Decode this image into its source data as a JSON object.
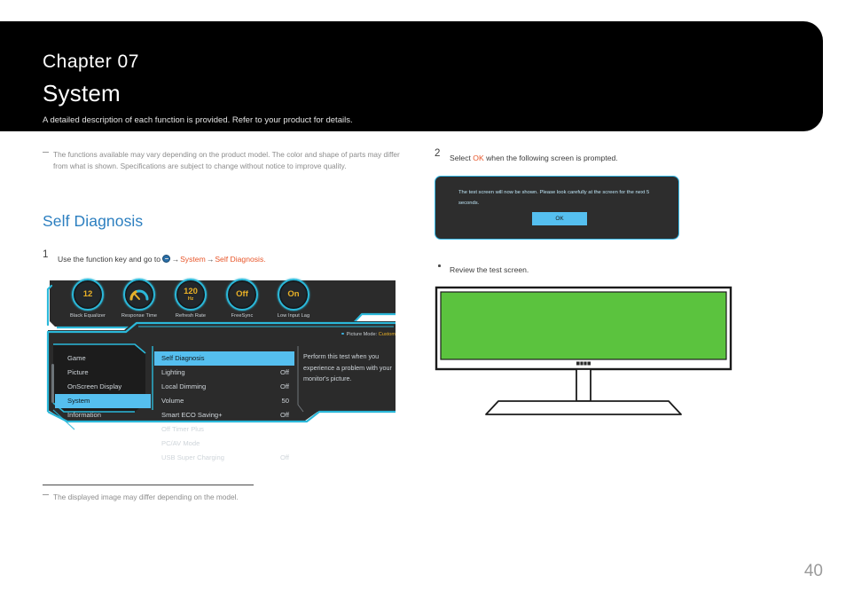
{
  "header": {
    "chapter_label": "Chapter  07",
    "title": "System",
    "description": "A detailed description of each function is provided. Refer to your product for details."
  },
  "footnotes": {
    "top": "The functions available may vary depending on the product model. The color and shape of parts may differ from what is shown. Specifications are subject to change without notice to improve quality.",
    "bottom": "The displayed image may differ depending on the model."
  },
  "section": {
    "title": "Self Diagnosis"
  },
  "steps": {
    "one": {
      "number": "1",
      "prefix": "Use the function key and go to ",
      "icon": "jog-key-icon",
      "arrow": "→",
      "link1": "System",
      "link2": "Self Diagnosis",
      "suffix": "."
    },
    "two": {
      "number": "2",
      "prefix": "Select ",
      "highlight": "OK",
      "suffix": " when the following screen is prompted."
    }
  },
  "bullet": {
    "text": "Review the test screen."
  },
  "osd": {
    "gauges": [
      {
        "value": "12",
        "unit": "",
        "label": "Black Equalizer",
        "icon": ""
      },
      {
        "value": "",
        "unit": "",
        "label": "Response Time",
        "icon": "speedometer-icon"
      },
      {
        "value": "120",
        "unit": "Hz",
        "label": "Refresh Rate",
        "icon": ""
      },
      {
        "value": "Off",
        "unit": "",
        "label": "FreeSync",
        "icon": ""
      },
      {
        "value": "On",
        "unit": "",
        "label": "Low Input Lag",
        "icon": ""
      }
    ],
    "picture_mode_label": "Picture Mode:",
    "picture_mode_value": "Custom",
    "nav": [
      {
        "label": "Game",
        "selected": false
      },
      {
        "label": "Picture",
        "selected": false
      },
      {
        "label": "OnScreen Display",
        "selected": false
      },
      {
        "label": "System",
        "selected": true
      },
      {
        "label": "Information",
        "selected": false
      }
    ],
    "list": [
      {
        "label": "Self Diagnosis",
        "value": "",
        "selected": true
      },
      {
        "label": "Lighting",
        "value": "Off",
        "selected": false
      },
      {
        "label": "Local Dimming",
        "value": "Off",
        "selected": false
      },
      {
        "label": "Volume",
        "value": "50",
        "selected": false
      },
      {
        "label": "Smart ECO Saving+",
        "value": "Off",
        "selected": false
      },
      {
        "label": "Off Timer Plus",
        "value": "",
        "selected": false
      },
      {
        "label": "PC/AV Mode",
        "value": "",
        "selected": false
      },
      {
        "label": "USB Super Charging",
        "value": "Off",
        "selected": false
      }
    ],
    "description": "Perform this test when you experience a problem with your monitor's picture."
  },
  "dialog": {
    "message": "The test screen will now be shown. Please look carefully at the screen for the next 5 seconds.",
    "ok_label": "OK"
  },
  "monitor": {
    "screen_color": "#5bc33e"
  },
  "page_number": "40",
  "colors": {
    "accent_blue": "#2c7fc0",
    "osd_cyan": "#2bb8d9",
    "osd_highlight": "#55bfef",
    "link_orange": "#e8562a",
    "gauge_yellow": "#e8b027"
  }
}
